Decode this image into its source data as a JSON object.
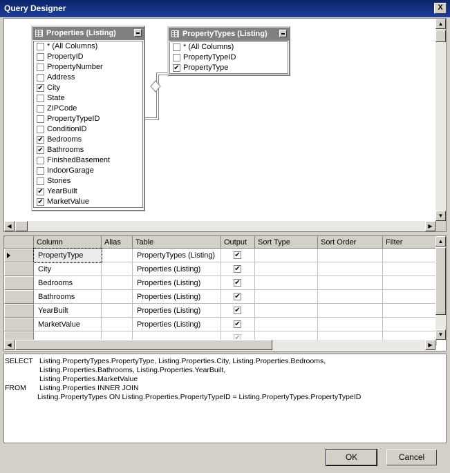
{
  "window": {
    "title": "Query Designer",
    "close_glyph": "X"
  },
  "tables": [
    {
      "title": "Properties (Listing)",
      "fields": [
        {
          "label": "* (All Columns)",
          "checked": false
        },
        {
          "label": "PropertyID",
          "checked": false
        },
        {
          "label": "PropertyNumber",
          "checked": false
        },
        {
          "label": "Address",
          "checked": false
        },
        {
          "label": "City",
          "checked": true
        },
        {
          "label": "State",
          "checked": false
        },
        {
          "label": "ZIPCode",
          "checked": false
        },
        {
          "label": "PropertyTypeID",
          "checked": false
        },
        {
          "label": "ConditionID",
          "checked": false
        },
        {
          "label": "Bedrooms",
          "checked": true
        },
        {
          "label": "Bathrooms",
          "checked": true
        },
        {
          "label": "FinishedBasement",
          "checked": false
        },
        {
          "label": "IndoorGarage",
          "checked": false
        },
        {
          "label": "Stories",
          "checked": false
        },
        {
          "label": "YearBuilt",
          "checked": true
        },
        {
          "label": "MarketValue",
          "checked": true
        }
      ]
    },
    {
      "title": "PropertyTypes (Listing)",
      "fields": [
        {
          "label": "* (All Columns)",
          "checked": false
        },
        {
          "label": "PropertyTypeID",
          "checked": false
        },
        {
          "label": "PropertyType",
          "checked": true
        }
      ]
    }
  ],
  "grid": {
    "headers": [
      "Column",
      "Alias",
      "Table",
      "Output",
      "Sort Type",
      "Sort Order",
      "Filter"
    ],
    "rows": [
      {
        "column": "PropertyType",
        "alias": "",
        "table": "PropertyTypes (Listing)",
        "output": true
      },
      {
        "column": "City",
        "alias": "",
        "table": "Properties (Listing)",
        "output": true
      },
      {
        "column": "Bedrooms",
        "alias": "",
        "table": "Properties (Listing)",
        "output": true
      },
      {
        "column": "Bathrooms",
        "alias": "",
        "table": "Properties (Listing)",
        "output": true
      },
      {
        "column": "YearBuilt",
        "alias": "",
        "table": "Properties (Listing)",
        "output": true
      },
      {
        "column": "MarketValue",
        "alias": "",
        "table": "Properties (Listing)",
        "output": true
      }
    ]
  },
  "sql": {
    "select_kw": "SELECT",
    "select_lines": [
      "Listing.PropertyTypes.PropertyType, Listing.Properties.City, Listing.Properties.Bedrooms,",
      "Listing.Properties.Bathrooms, Listing.Properties.YearBuilt,",
      "Listing.Properties.MarketValue"
    ],
    "from_kw": "FROM",
    "from_lines": [
      "Listing.Properties INNER JOIN",
      "Listing.PropertyTypes ON Listing.Properties.PropertyTypeID = Listing.PropertyTypes.PropertyTypeID"
    ]
  },
  "buttons": {
    "ok": "OK",
    "cancel": "Cancel"
  },
  "check_glyph": "✔"
}
